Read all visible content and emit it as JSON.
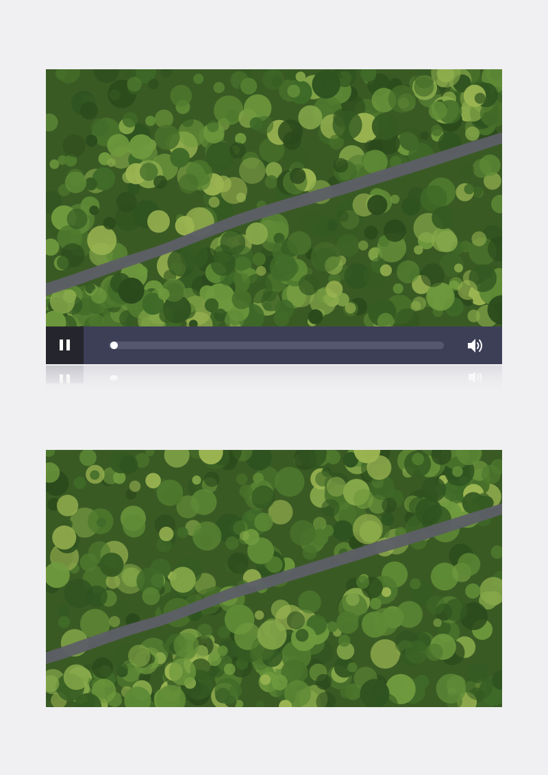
{
  "player": {
    "state": "playing",
    "play_pause_icon": "pause-icon",
    "volume_icon": "speaker-volume-icon",
    "progress_fraction": 0.0
  },
  "colors": {
    "page_background": "#f0f0f2",
    "control_bar": "#3d3f57",
    "play_button_bg": "#25262d",
    "progress_track": "#55576f",
    "icon": "#ffffff",
    "forest_dark": "#2f4a1f",
    "forest_mid": "#4f7a2e",
    "forest_light": "#8db04a",
    "river": "#5d5f66"
  },
  "media": {
    "top_frame_content": "aerial-forest-river",
    "bottom_frame_content": "aerial-forest-river"
  }
}
